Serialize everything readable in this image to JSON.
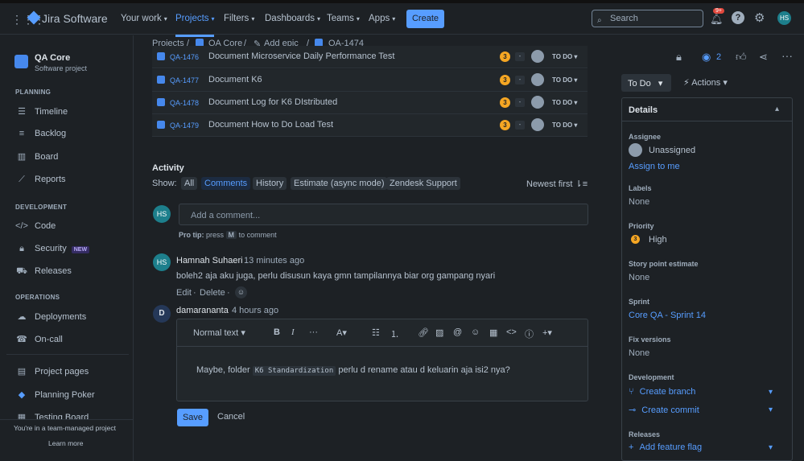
{
  "topbar": {
    "app_name": "Jira Software",
    "nav": [
      {
        "label": "Your work"
      },
      {
        "label": "Projects"
      },
      {
        "label": "Filters"
      },
      {
        "label": "Dashboards"
      },
      {
        "label": "Teams"
      },
      {
        "label": "Apps"
      }
    ],
    "create_label": "Create",
    "search_placeholder": "Search",
    "notif_badge": "9+",
    "user_initials": "HS"
  },
  "sidebar": {
    "project_name": "QA Core",
    "project_type": "Software project",
    "sections": {
      "planning": "PLANNING",
      "development": "DEVELOPMENT",
      "operations": "OPERATIONS"
    },
    "planning_items": [
      "Timeline",
      "Backlog",
      "Board",
      "Reports"
    ],
    "development_items": [
      "Code",
      "Security",
      "Releases"
    ],
    "security_badge": "NEW",
    "operations_items": [
      "Deployments",
      "On-call"
    ],
    "extra_items": [
      "Project pages",
      "Planning Poker",
      "Testing Board"
    ],
    "footer_text": "You're in a team-managed project",
    "footer_link": "Learn more"
  },
  "breadcrumb": {
    "projects": "Projects",
    "project": "QA Core",
    "add_epic": "Add epic",
    "issue": "QA-1474"
  },
  "child_issues": [
    {
      "key": "QA-1476",
      "summary": "Document Microservice Daily Performance Test",
      "priority": "3",
      "points": "-",
      "status": "TO DO"
    },
    {
      "key": "QA-1477",
      "summary": "Document K6",
      "priority": "3",
      "points": "-",
      "status": "TO DO"
    },
    {
      "key": "QA-1478",
      "summary": "Document Log for K6 DIstributed",
      "priority": "3",
      "points": "-",
      "status": "TO DO"
    },
    {
      "key": "QA-1479",
      "summary": "Document How to Do Load Test",
      "priority": "3",
      "points": "-",
      "status": "TO DO"
    }
  ],
  "activity": {
    "title": "Activity",
    "show_label": "Show:",
    "tabs": [
      "All",
      "Comments",
      "History",
      "Estimate (async mode)",
      "Zendesk Support"
    ],
    "sort_label": "Newest first",
    "comment_placeholder": "Add a comment...",
    "pro_tip_bold": "Pro tip:",
    "pro_tip_text": "press",
    "pro_tip_key": "M",
    "pro_tip_tail": "to comment",
    "comments": [
      {
        "author": "Hamnah Suhaeri",
        "time": "13 minutes ago",
        "initials": "HS",
        "body": "boleh2 aja aku juga, perlu disusun kaya gmn tampilannya biar org gampang nyari",
        "edit": "Edit",
        "delete": "Delete"
      }
    ],
    "editing": {
      "author": "damarananta",
      "time": "4 hours ago",
      "initial": "D",
      "format_label": "Normal text",
      "text_before": "Maybe, folder",
      "code": "K6 Standardization",
      "text_after": "perlu d rename atau d keluarin aja isi2 nya?",
      "save_label": "Save",
      "cancel_label": "Cancel"
    }
  },
  "right_panel": {
    "watch_count": "2",
    "status": "To Do",
    "actions_label": "Actions",
    "details_title": "Details",
    "assignee_label": "Assignee",
    "assignee_value": "Unassigned",
    "assign_to_me": "Assign to me",
    "labels_label": "Labels",
    "labels_value": "None",
    "priority_label": "Priority",
    "priority_value": "High",
    "priority_icon_text": "3",
    "story_points_label": "Story point estimate",
    "story_points_value": "None",
    "sprint_label": "Sprint",
    "sprint_value": "Core QA - Sprint 14",
    "fix_versions_label": "Fix versions",
    "fix_versions_value": "None",
    "development_label": "Development",
    "create_branch": "Create branch",
    "create_commit": "Create commit",
    "releases_label": "Releases",
    "add_feature_flag": "Add feature flag"
  }
}
